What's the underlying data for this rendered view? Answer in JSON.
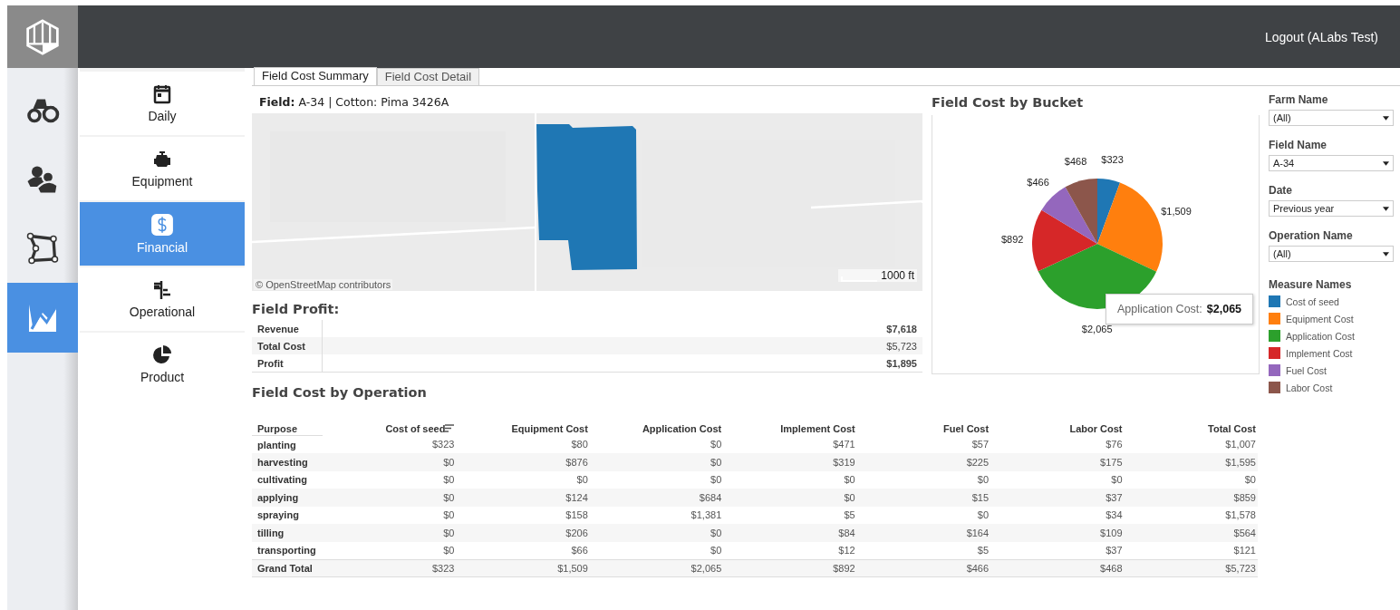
{
  "header": {
    "logout": "Logout (ALabs Test)"
  },
  "rail": [
    {
      "selected": false
    },
    {
      "selected": false
    },
    {
      "selected": false
    },
    {
      "selected": true
    }
  ],
  "menu": [
    {
      "label": "Daily",
      "selected": false
    },
    {
      "label": "Equipment",
      "selected": false
    },
    {
      "label": "Financial",
      "selected": true
    },
    {
      "label": "Operational",
      "selected": false
    },
    {
      "label": "Product",
      "selected": false
    }
  ],
  "tabs": [
    {
      "label": "Field Cost Summary",
      "selected": true
    },
    {
      "label": "Field Cost Detail",
      "selected": false
    }
  ],
  "field_title": "**Field:** A-34 | Cotton: Pima 3426A",
  "map": {
    "attribution": "© OpenStreetMap contributors",
    "scale": "1000 ft"
  },
  "profit": {
    "title": "Field Profit:",
    "rows": [
      {
        "label": "Revenue",
        "value": "$7,618"
      },
      {
        "label": "Total Cost",
        "value": "$5,723"
      },
      {
        "label": "Profit",
        "value": "$1,895"
      }
    ]
  },
  "bucket": {
    "title": "Field Cost by Bucket",
    "tooltip": {
      "label": "Application Cost:",
      "value": "$2,065"
    },
    "chart_data": {
      "type": "pie",
      "values": [
        323,
        1509,
        2065,
        892,
        466,
        468
      ],
      "value_labels": [
        "$323",
        "$1,509",
        "$2,065",
        "$892",
        "$466",
        "$468"
      ]
    }
  },
  "filters": [
    {
      "label": "Farm Name",
      "value": "(All)"
    },
    {
      "label": "Field Name",
      "value": "A-34"
    },
    {
      "label": "Date",
      "value": "Previous year"
    },
    {
      "label": "Operation Name",
      "value": "(All)"
    }
  ],
  "legend": {
    "title": "Measure Names",
    "items": [
      {
        "label": "Cost of seed",
        "color": "#1f77b4"
      },
      {
        "label": "Equipment Cost",
        "color": "#ff7f0e"
      },
      {
        "label": "Application Cost",
        "color": "#2ca02c"
      },
      {
        "label": "Implement Cost",
        "color": "#d62728"
      },
      {
        "label": "Fuel Cost",
        "color": "#9467bd"
      },
      {
        "label": "Labor Cost",
        "color": "#8c564b"
      }
    ]
  },
  "operation": {
    "title": "Field Cost by Operation",
    "columns": [
      {
        "label": "Purpose",
        "sorted": false
      },
      {
        "label": "Cost of seed",
        "sorted": true
      },
      {
        "label": "Equipment Cost",
        "sorted": false
      },
      {
        "label": "Application Cost",
        "sorted": false
      },
      {
        "label": "Implement Cost",
        "sorted": false
      },
      {
        "label": "Fuel Cost",
        "sorted": false
      },
      {
        "label": "Labor Cost",
        "sorted": false
      },
      {
        "label": "Total Cost",
        "sorted": false
      }
    ],
    "rows": [
      {
        "kind": "data",
        "cells": [
          "planting",
          "$323",
          "$80",
          "$0",
          "$471",
          "$57",
          "$76",
          "$1,007"
        ]
      },
      {
        "kind": "data",
        "cells": [
          "harvesting",
          "$0",
          "$876",
          "$0",
          "$319",
          "$225",
          "$175",
          "$1,595"
        ]
      },
      {
        "kind": "data",
        "cells": [
          "cultivating",
          "$0",
          "$0",
          "$0",
          "$0",
          "$0",
          "$0",
          "$0"
        ]
      },
      {
        "kind": "data",
        "cells": [
          "applying",
          "$0",
          "$124",
          "$684",
          "$0",
          "$15",
          "$37",
          "$859"
        ]
      },
      {
        "kind": "data",
        "cells": [
          "spraying",
          "$0",
          "$158",
          "$1,381",
          "$5",
          "$0",
          "$34",
          "$1,578"
        ]
      },
      {
        "kind": "data",
        "cells": [
          "tilling",
          "$0",
          "$206",
          "$0",
          "$84",
          "$164",
          "$109",
          "$564"
        ]
      },
      {
        "kind": "data",
        "cells": [
          "transporting",
          "$0",
          "$66",
          "$0",
          "$12",
          "$5",
          "$37",
          "$121"
        ]
      },
      {
        "kind": "total",
        "cells": [
          "Grand Total",
          "$323",
          "$1,509",
          "$2,065",
          "$892",
          "$466",
          "$468",
          "$5,723"
        ]
      }
    ]
  }
}
